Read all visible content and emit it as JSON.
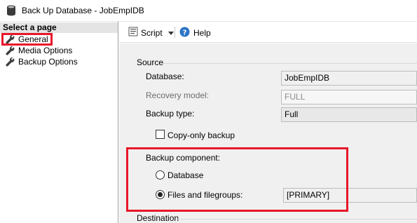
{
  "window": {
    "title": "Back Up Database - JobEmpIDB",
    "icon": "database-icon"
  },
  "sidebar": {
    "header": "Select a page",
    "items": [
      {
        "label": "General",
        "icon": "wrench-icon",
        "selected": true
      },
      {
        "label": "Media Options",
        "icon": "wrench-icon"
      },
      {
        "label": "Backup Options",
        "icon": "wrench-icon"
      }
    ]
  },
  "toolbar": {
    "script_label": "Script",
    "script_icon": "script-icon",
    "dropdown_icon": "chevron-down-icon",
    "help_label": "Help",
    "help_icon": "help-icon"
  },
  "source": {
    "group_label": "Source",
    "database_label": "Database:",
    "database_value": "JobEmpIDB",
    "recovery_model_label": "Recovery model:",
    "recovery_model_value": "FULL",
    "backup_type_label": "Backup type:",
    "backup_type_value": "Full",
    "copy_only_label": "Copy-only backup",
    "copy_only_checked": false
  },
  "backup_component": {
    "label": "Backup component:",
    "option_database": "Database",
    "option_files": "Files and filegroups:",
    "selected": "Files and filegroups:",
    "files_value": "[PRIMARY]"
  },
  "destination": {
    "group_label": "Destination"
  },
  "colors": {
    "highlight": "#e8182a",
    "panel_bg": "#f0f0f0",
    "header_bg": "#e4e4e4"
  }
}
